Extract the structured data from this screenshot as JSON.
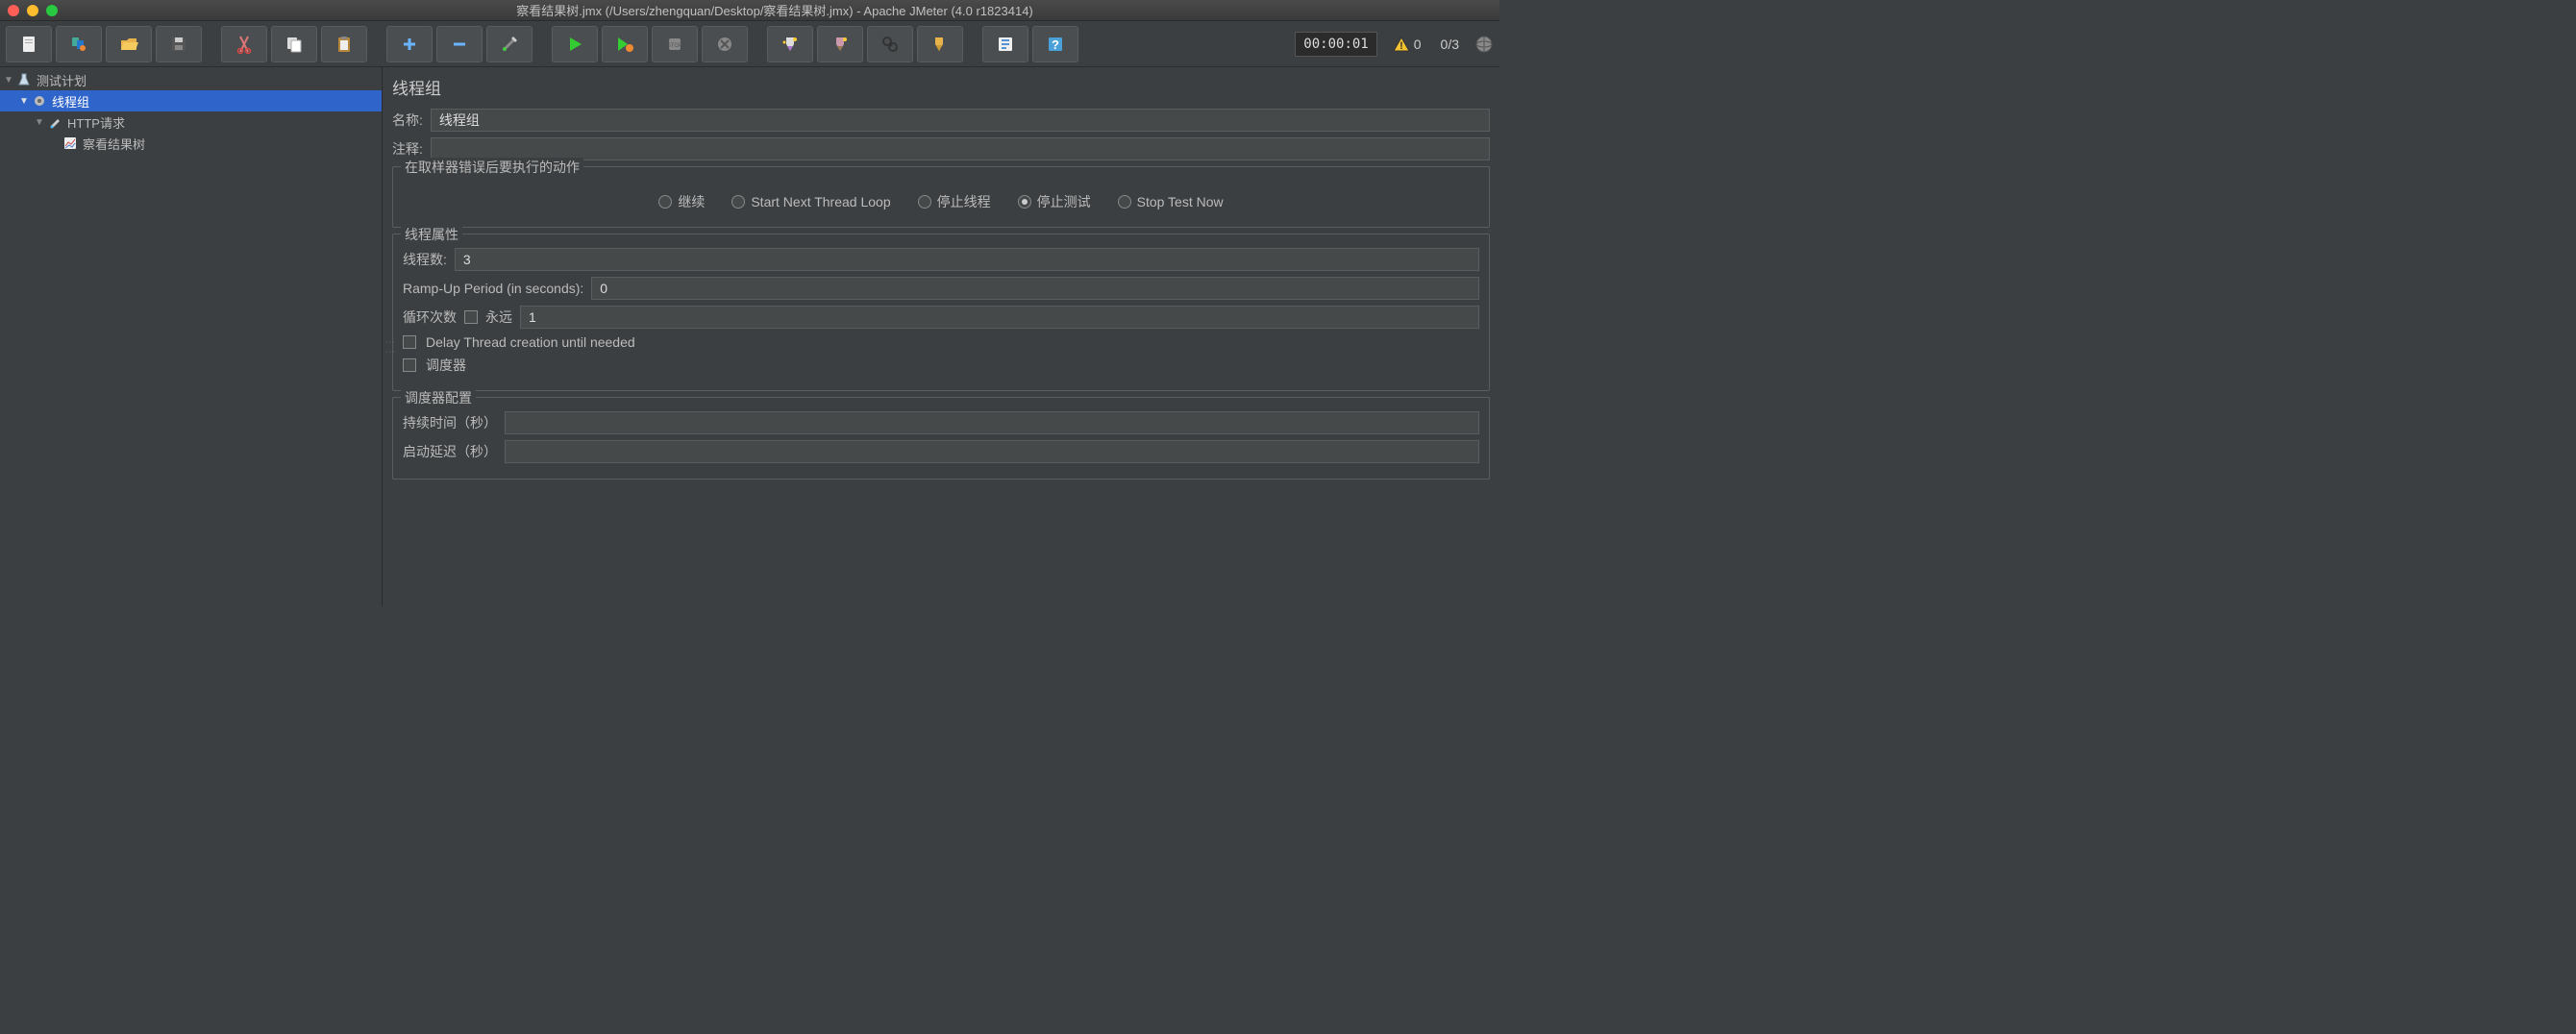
{
  "window": {
    "title": "察看结果树.jmx (/Users/zhengquan/Desktop/察看结果树.jmx) - Apache JMeter (4.0 r1823414)"
  },
  "toolbar": {
    "timer": "00:00:01",
    "warn_count": "0",
    "ratio": "0/3"
  },
  "tree": {
    "test_plan": "测试计划",
    "thread_group": "线程组",
    "http_request": "HTTP请求",
    "view_results": "察看结果树"
  },
  "panel": {
    "title": "线程组",
    "name_label": "名称:",
    "name_value": "线程组",
    "comment_label": "注释:",
    "comment_value": "",
    "error_action": {
      "legend": "在取样器错误后要执行的动作",
      "opt_continue": "继续",
      "opt_next_loop": "Start Next Thread Loop",
      "opt_stop_thread": "停止线程",
      "opt_stop_test": "停止测试",
      "opt_stop_now": "Stop Test Now",
      "selected": "opt_stop_test"
    },
    "thread_props": {
      "legend": "线程属性",
      "threads_label": "线程数:",
      "threads_value": "3",
      "rampup_label": "Ramp-Up Period (in seconds):",
      "rampup_value": "0",
      "loop_label": "循环次数",
      "forever_label": "永远",
      "loop_value": "1",
      "delay_label": "Delay Thread creation until needed",
      "scheduler_label": "调度器"
    },
    "scheduler": {
      "legend": "调度器配置",
      "duration_label": "持续时间（秒）",
      "duration_value": "",
      "delay_label": "启动延迟（秒）",
      "delay_value": ""
    }
  }
}
